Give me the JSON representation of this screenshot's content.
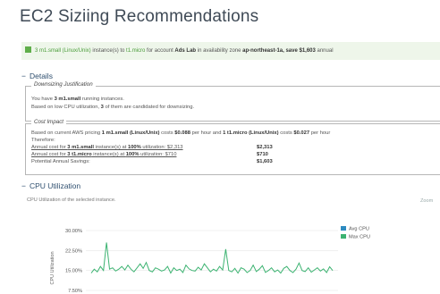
{
  "title": "EC2 Siziing Recommendations",
  "notice": {
    "part1": "3 m1.small (Linux/Unix)",
    "part2": " instance(s) to ",
    "part3": "t1.micro",
    "part4": " for account ",
    "part5": "Ads Lab",
    "part6": " in availability zone ",
    "part7": "ap-northeast-1a",
    "part8": ", save $1,603",
    "part9": " annual"
  },
  "details": {
    "heading": "Details",
    "downsizing": {
      "legend": "Downsizing Justification",
      "line1_a": "You have ",
      "line1_b": "3 m1.small",
      "line1_c": " running instances.",
      "line2_a": "Based on low CPU utilization, ",
      "line2_b": "3",
      "line2_c": " of them are candidated for downsizing."
    },
    "cost": {
      "legend": "Cost Impact",
      "line1_a": "Based on current AWS pricing ",
      "line1_b": "1 m1.small (Linux/Unix)",
      "line1_c": " costs ",
      "line1_d": "$0.088",
      "line1_e": " per hour and ",
      "line1_f": "1 t1.micro (Linux/Unix)",
      "line1_g": " costs ",
      "line1_h": "$0.027",
      "line1_i": " per hour",
      "line2": "Therefore:",
      "row1_a": "Annual cost for ",
      "row1_b": "3 m1.small",
      "row1_c": " instance(s) at ",
      "row1_d": "100%",
      "row1_e": " utilization: $2,313",
      "row1_val": "$2,313",
      "row2_a": "Annual cost for ",
      "row2_b": "3 t1.micro",
      "row2_c": " instance(s) at ",
      "row2_d": "100%",
      "row2_e": " utilization: $710",
      "row2_val": "$710",
      "row3": "Potential Annual Savings:",
      "row3_val": "$1,603"
    }
  },
  "cpu": {
    "heading": "CPU Utilization",
    "caption": "CPU Utilization of the selected instance.",
    "zoom": "Zoom"
  },
  "colors": {
    "avg": "#2e8bc0",
    "max": "#3cb371",
    "accent": "#2f4f6f"
  },
  "chart_data": {
    "type": "line",
    "ylabel": "CPU Utilization",
    "ylim": [
      0,
      30
    ],
    "yticks": [
      "30.00%",
      "22.50%",
      "15.00%",
      "7.50%"
    ],
    "yticks_values": [
      30,
      22.5,
      15,
      7.5
    ],
    "series": [
      {
        "name": "Avg CPU",
        "values": []
      },
      {
        "name": "Max CPU",
        "values": [
          14.0,
          15.5,
          14.5,
          16.5,
          15.0,
          25.5,
          15.5,
          16.0,
          14.8,
          15.5,
          16.5,
          15.2,
          17.0,
          15.5,
          14.5,
          16.0,
          17.5,
          15.8,
          18.0,
          15.0,
          14.5,
          16.0,
          15.5,
          14.8,
          15.2,
          16.5,
          14.0,
          16.0,
          15.0,
          15.5,
          14.2,
          17.0,
          15.6,
          15.0,
          14.8,
          16.2,
          15.2,
          17.5,
          16.0,
          14.5,
          15.5,
          14.8,
          16.5,
          15.2,
          23.0,
          15.0,
          14.5,
          15.8,
          14.0,
          16.0,
          15.5,
          14.2,
          15.0,
          17.0,
          14.6,
          15.5,
          16.8,
          14.3,
          15.0,
          16.0,
          14.5,
          15.2,
          14.0,
          15.8,
          16.5,
          15.0,
          14.2,
          15.5,
          17.8,
          15.0,
          14.6,
          16.0,
          14.4,
          15.2,
          16.0,
          14.8,
          15.6,
          14.2,
          16.4,
          15.0
        ]
      }
    ]
  }
}
